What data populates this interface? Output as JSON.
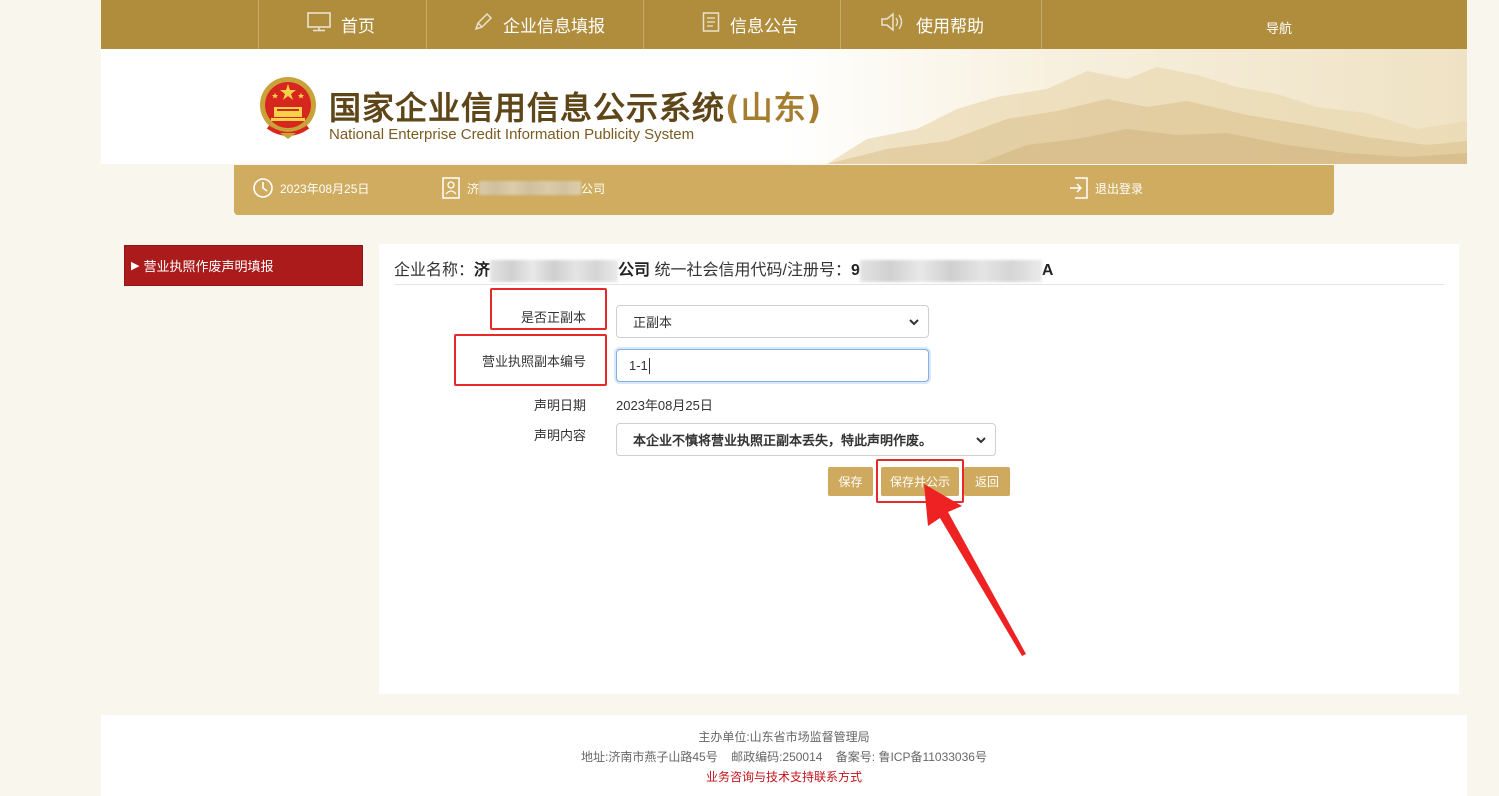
{
  "nav": {
    "items": [
      {
        "label": "首页",
        "icon": "monitor-icon"
      },
      {
        "label": "企业信息填报",
        "icon": "pen-icon"
      },
      {
        "label": "信息公告",
        "icon": "document-icon"
      },
      {
        "label": "使用帮助",
        "icon": "speaker-icon"
      }
    ],
    "hint": "导航"
  },
  "header": {
    "title": "国家企业信用信息公示系统",
    "title_region": "(山东)",
    "subtitle": "National Enterprise Credit Information Publicity System"
  },
  "infobar": {
    "date": "2023年08月25日",
    "company_prefix": "济",
    "company_suffix": "公司",
    "logout": "退出登录"
  },
  "sidebar": {
    "items": [
      {
        "label": "营业执照作废声明填报",
        "active": true
      }
    ]
  },
  "company": {
    "name_label": "企业名称：",
    "name_prefix": "济",
    "name_suffix": "公司",
    "code_label": "统一社会信用代码/注册号：",
    "code_prefix": "9",
    "code_suffix": "A"
  },
  "form": {
    "copy_type_label": "是否正副本",
    "copy_type_value": "正副本",
    "license_no_label": "营业执照副本编号",
    "license_no_value": "1-1",
    "date_label": "声明日期",
    "date_value": "2023年08月25日",
    "content_label": "声明内容",
    "content_value": "本企业不慎将营业执照正副本丢失，特此声明作废。"
  },
  "buttons": {
    "save": "保存",
    "save_publish": "保存并公示",
    "back": "返回"
  },
  "footer": {
    "sponsor": "主办单位:山东省市场监督管理局",
    "address": "地址:济南市燕子山路45号    邮政编码:250014    备案号: 鲁ICP备11033036号",
    "contact": "业务咨询与技术支持联系方式"
  },
  "colors": {
    "nav_bg": "#b08d3c",
    "infobar_bg": "#cfac5f",
    "sidebar_active": "#ab1b1b",
    "button": "#cfa95d",
    "annotation": "#e62a2a"
  }
}
